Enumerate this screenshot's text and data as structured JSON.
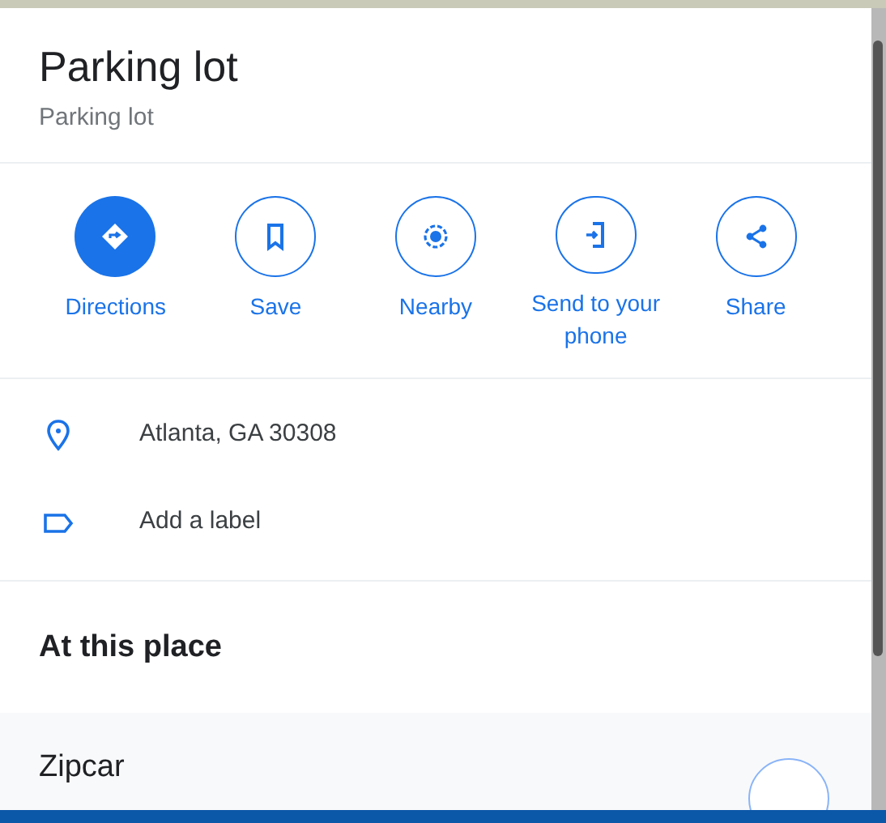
{
  "place": {
    "title": "Parking lot",
    "category": "Parking lot"
  },
  "actions": [
    {
      "kind": "directions",
      "label": "Directions",
      "filled": true
    },
    {
      "kind": "save",
      "label": "Save",
      "filled": false
    },
    {
      "kind": "nearby",
      "label": "Nearby",
      "filled": false
    },
    {
      "kind": "send",
      "label": "Send to your phone",
      "filled": false
    },
    {
      "kind": "share",
      "label": "Share",
      "filled": false
    }
  ],
  "info_rows": [
    {
      "kind": "address",
      "text": "Atlanta, GA 30308"
    },
    {
      "kind": "label",
      "text": "Add a label"
    }
  ],
  "section": {
    "heading": "At this place"
  },
  "places": [
    {
      "name": "Zipcar"
    }
  ]
}
